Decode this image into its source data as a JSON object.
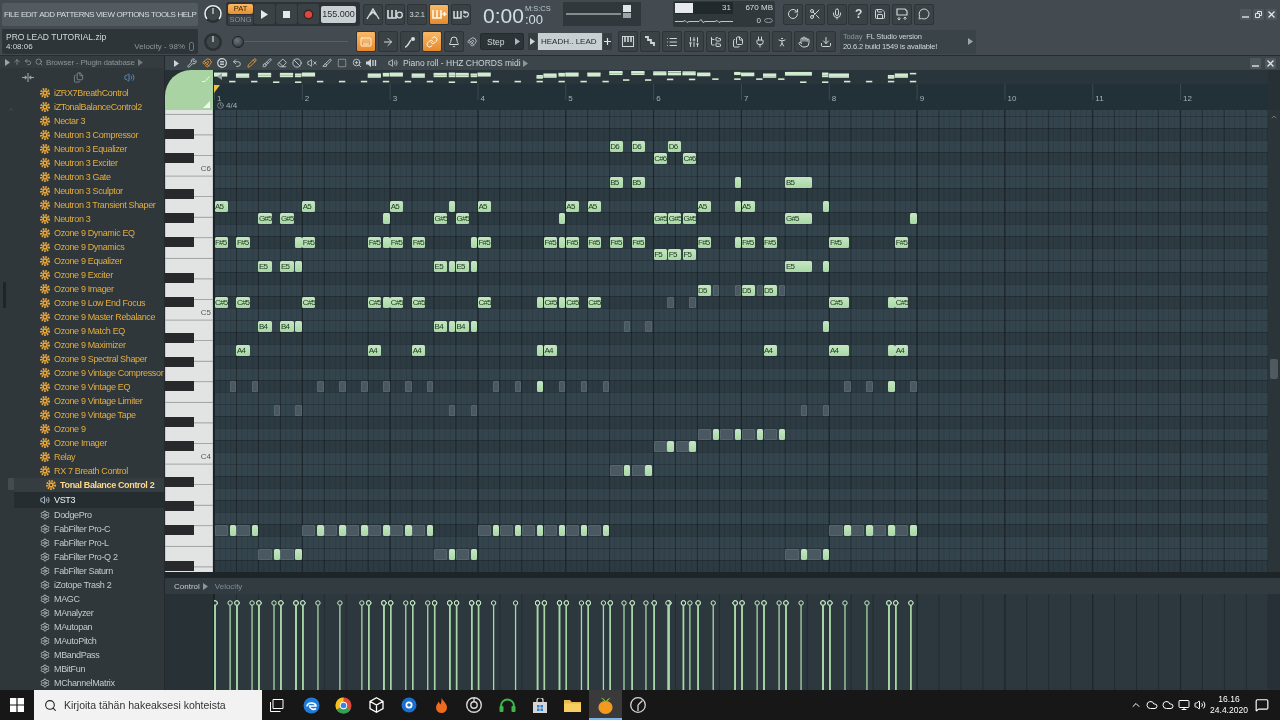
{
  "menu": [
    "FILE",
    "EDIT",
    "ADD",
    "PATTERNS",
    "VIEW",
    "OPTIONS",
    "TOOLS",
    "HELP"
  ],
  "project": {
    "name": "PRO LEAD TUTORIAL.zip",
    "time": "4:08:06",
    "hint": "Velocity - 98%"
  },
  "transport": {
    "mode": [
      {
        "label": "PAT",
        "selected": true
      },
      {
        "label": "SONG",
        "selected": false
      }
    ],
    "tempo": "155.000"
  },
  "record_buttons": [
    {
      "kind": "metronome",
      "on": false
    },
    {
      "kind": "comb-circle",
      "on": false
    },
    {
      "label": "3.2.1",
      "on": false
    },
    {
      "kind": "comb-plus",
      "on": true
    },
    {
      "kind": "comb-loop",
      "on": false
    }
  ],
  "clock": {
    "main": "0:00",
    "sub": ":00",
    "unit": "M:S:CS"
  },
  "monitor": {
    "cpu": "31",
    "level": 0.31,
    "memory": "670 MB",
    "voices": "0"
  },
  "system_buttons": [
    {
      "kind": "refresh"
    },
    {
      "kind": "scissors"
    },
    {
      "kind": "microphone"
    },
    {
      "label": "?"
    },
    {
      "kind": "save"
    },
    {
      "kind": "floppy-arrows"
    },
    {
      "kind": "chat"
    }
  ],
  "edit_buttons": [
    {
      "kind": "keyboard",
      "on": true
    },
    {
      "kind": "arrow-right",
      "on": false
    },
    {
      "kind": "pen-curve",
      "on": false
    },
    {
      "kind": "link",
      "on": true
    },
    {
      "kind": "bell",
      "on": false
    }
  ],
  "snap": {
    "value": "Step"
  },
  "pitch_slider": {
    "level": 0
  },
  "channel": {
    "name": "HEADH.. LEAD"
  },
  "window_buttons": [
    {
      "kind": "piano-keys"
    },
    {
      "kind": "stairs"
    },
    {
      "kind": "list"
    },
    {
      "kind": "sliders"
    },
    {
      "kind": "folder-tree"
    },
    {
      "kind": "pages"
    },
    {
      "kind": "plug"
    },
    {
      "kind": "person"
    },
    {
      "kind": "hand"
    },
    {
      "kind": "download"
    }
  ],
  "hint_panel": {
    "when": "Today",
    "title": "FL Studio version",
    "message": "20.6.2 build 1549 is available!"
  },
  "browser": {
    "title": "Browser - Plugin database",
    "items": [
      {
        "label": "iZRX7BreathControl",
        "kind": "fx",
        "selected": false
      },
      {
        "label": "iZTonalBalanceControl2",
        "kind": "fx",
        "selected": false
      },
      {
        "label": "Nectar 3",
        "kind": "fx",
        "selected": false
      },
      {
        "label": "Neutron 3 Compressor",
        "kind": "fx",
        "selected": false
      },
      {
        "label": "Neutron 3 Equalizer",
        "kind": "fx",
        "selected": false
      },
      {
        "label": "Neutron 3 Exciter",
        "kind": "fx",
        "selected": false
      },
      {
        "label": "Neutron 3 Gate",
        "kind": "fx",
        "selected": false
      },
      {
        "label": "Neutron 3 Sculptor",
        "kind": "fx",
        "selected": false
      },
      {
        "label": "Neutron 3 Transient Shaper",
        "kind": "fx",
        "selected": false
      },
      {
        "label": "Neutron 3",
        "kind": "fx",
        "selected": false
      },
      {
        "label": "Ozone 9 Dynamic EQ",
        "kind": "fx",
        "selected": false
      },
      {
        "label": "Ozone 9 Dynamics",
        "kind": "fx",
        "selected": false
      },
      {
        "label": "Ozone 9 Equalizer",
        "kind": "fx",
        "selected": false
      },
      {
        "label": "Ozone 9 Exciter",
        "kind": "fx",
        "selected": false
      },
      {
        "label": "Ozone 9 Imager",
        "kind": "fx",
        "selected": false
      },
      {
        "label": "Ozone 9 Low End Focus",
        "kind": "fx",
        "selected": false
      },
      {
        "label": "Ozone 9 Master Rebalance",
        "kind": "fx",
        "selected": false
      },
      {
        "label": "Ozone 9 Match EQ",
        "kind": "fx",
        "selected": false
      },
      {
        "label": "Ozone 9 Maximizer",
        "kind": "fx",
        "selected": false
      },
      {
        "label": "Ozone 9 Spectral Shaper",
        "kind": "fx",
        "selected": false
      },
      {
        "label": "Ozone 9 Vintage Compressor",
        "kind": "fx",
        "selected": false
      },
      {
        "label": "Ozone 9 Vintage EQ",
        "kind": "fx",
        "selected": false
      },
      {
        "label": "Ozone 9 Vintage Limiter",
        "kind": "fx",
        "selected": false
      },
      {
        "label": "Ozone 9 Vintage Tape",
        "kind": "fx",
        "selected": false
      },
      {
        "label": "Ozone 9",
        "kind": "fx",
        "selected": false
      },
      {
        "label": "Ozone Imager",
        "kind": "fx",
        "selected": false
      },
      {
        "label": "Relay",
        "kind": "fx",
        "selected": false
      },
      {
        "label": "RX 7 Breath Control",
        "kind": "fx",
        "selected": false
      },
      {
        "label": "Tonal Balance Control 2",
        "kind": "fx",
        "selected": true
      },
      {
        "label": "VST3",
        "kind": "folder",
        "selected": false
      },
      {
        "label": "DodgePro",
        "kind": "vst",
        "selected": false
      },
      {
        "label": "FabFilter Pro-C",
        "kind": "vst",
        "selected": false
      },
      {
        "label": "FabFilter Pro-L",
        "kind": "vst",
        "selected": false
      },
      {
        "label": "FabFilter Pro-Q 2",
        "kind": "vst",
        "selected": false
      },
      {
        "label": "FabFilter Saturn",
        "kind": "vst",
        "selected": false
      },
      {
        "label": "iZotope Trash 2",
        "kind": "vst",
        "selected": false
      },
      {
        "label": "MAGC",
        "kind": "vst",
        "selected": false
      },
      {
        "label": "MAnalyzer",
        "kind": "vst",
        "selected": false
      },
      {
        "label": "MAutopan",
        "kind": "vst",
        "selected": false
      },
      {
        "label": "MAutoPitch",
        "kind": "vst",
        "selected": false
      },
      {
        "label": "MBandPass",
        "kind": "vst",
        "selected": false
      },
      {
        "label": "MBitFun",
        "kind": "vst",
        "selected": false
      },
      {
        "label": "MChannelMatrix",
        "kind": "vst",
        "selected": false
      }
    ]
  },
  "piano_roll": {
    "title": "Piano roll - HHZ CHORDS midi",
    "tools": [
      {
        "kind": "caret-right",
        "on": false
      },
      {
        "kind": "wrench",
        "on": false
      },
      {
        "kind": "magnet",
        "on": true
      },
      {
        "kind": "circle-lines",
        "on": false
      },
      {
        "kind": "undo",
        "on": false
      },
      {
        "kind": "pencil",
        "on": true
      },
      {
        "kind": "brush",
        "on": false
      },
      {
        "kind": "eraser",
        "on": false
      },
      {
        "kind": "ban",
        "on": false
      },
      {
        "kind": "speaker-off",
        "on": false
      },
      {
        "kind": "knife",
        "on": false
      },
      {
        "kind": "dashed-square",
        "on": false
      },
      {
        "kind": "zoom",
        "on": false
      },
      {
        "kind": "speaker-bars",
        "on": false
      }
    ],
    "bars": [
      "1",
      "2",
      "3",
      "4",
      "5",
      "6",
      "7",
      "8",
      "9",
      "10",
      "11",
      "12"
    ],
    "time_signature": "4/4",
    "key_labels": [
      "C6",
      "C5",
      "C4"
    ],
    "notes": [
      {
        "label": "D6",
        "ghost": false
      },
      {
        "label": "D6",
        "ghost": false
      },
      {
        "label": "D6",
        "ghost": false
      },
      {
        "label": "C#6",
        "ghost": false
      },
      {
        "label": "C#6",
        "ghost": false
      },
      {
        "label": "B5",
        "ghost": false
      },
      {
        "label": "B5",
        "ghost": false
      },
      {
        "ghost": false
      },
      {
        "label": "B5",
        "ghost": false
      },
      {
        "label": "A5",
        "ghost": false
      },
      {
        "label": "A5",
        "ghost": false
      },
      {
        "label": "A5",
        "ghost": false
      },
      {
        "ghost": false
      },
      {
        "label": "A5",
        "ghost": false
      },
      {
        "label": "A5",
        "ghost": false
      },
      {
        "label": "A5",
        "ghost": false
      },
      {
        "label": "A5",
        "ghost": false
      },
      {
        "ghost": false
      },
      {
        "label": "A5",
        "ghost": false
      },
      {
        "ghost": false
      },
      {
        "label": "G#5",
        "ghost": false
      },
      {
        "label": "G#5",
        "ghost": false
      },
      {
        "ghost": false
      },
      {
        "label": "G#5",
        "ghost": false
      },
      {
        "label": "G#5",
        "ghost": false
      },
      {
        "ghost": false
      },
      {
        "label": "G#5",
        "ghost": false
      },
      {
        "label": "G#5",
        "ghost": false
      },
      {
        "label": "G#5",
        "ghost": false
      },
      {
        "label": "G#5",
        "ghost": false
      },
      {
        "ghost": false
      },
      {
        "label": "F#5",
        "ghost": false
      },
      {
        "label": "F#5",
        "ghost": false
      },
      {
        "ghost": false
      },
      {
        "label": "F#5",
        "ghost": false
      },
      {
        "label": "F#5",
        "ghost": false
      },
      {
        "ghost": false
      },
      {
        "label": "F#5",
        "ghost": false
      },
      {
        "label": "F#5",
        "ghost": false
      },
      {
        "ghost": false
      },
      {
        "label": "F#5",
        "ghost": false
      },
      {
        "label": "F#5",
        "ghost": false
      },
      {
        "ghost": false
      },
      {
        "label": "F#5",
        "ghost": false
      },
      {
        "label": "F#5",
        "ghost": false
      },
      {
        "label": "F#5",
        "ghost": false
      },
      {
        "label": "F#5",
        "ghost": false
      },
      {
        "label": "F#5",
        "ghost": false
      },
      {
        "ghost": false
      },
      {
        "label": "F#5",
        "ghost": false
      },
      {
        "label": "F#5",
        "ghost": false
      },
      {
        "label": "F#5",
        "ghost": false
      },
      {
        "label": "F#5",
        "ghost": false
      },
      {
        "label": "F5",
        "ghost": false
      },
      {
        "label": "F5",
        "ghost": false
      },
      {
        "label": "F5",
        "ghost": false
      },
      {
        "label": "E5",
        "ghost": false
      },
      {
        "label": "E5",
        "ghost": false
      },
      {
        "ghost": false
      },
      {
        "label": "E5",
        "ghost": false
      },
      {
        "ghost": false
      },
      {
        "label": "E5",
        "ghost": false
      },
      {
        "ghost": false
      },
      {
        "label": "E5",
        "ghost": false
      },
      {
        "ghost": false
      },
      {
        "label": "D5",
        "ghost": false
      },
      {
        "ghost": true
      },
      {
        "ghost": true
      },
      {
        "label": "D5",
        "ghost": false
      },
      {
        "ghost": true
      },
      {
        "label": "D5",
        "ghost": false
      },
      {
        "ghost": true
      },
      {
        "label": "C#5",
        "ghost": false
      },
      {
        "label": "C#5",
        "ghost": false
      },
      {
        "label": "C#5",
        "ghost": false
      },
      {
        "label": "C#5",
        "ghost": false
      },
      {
        "ghost": false
      },
      {
        "label": "C#5",
        "ghost": false
      },
      {
        "label": "C#5",
        "ghost": false
      },
      {
        "label": "C#5",
        "ghost": false
      },
      {
        "ghost": false
      },
      {
        "label": "C#5",
        "ghost": false
      },
      {
        "ghost": false
      },
      {
        "label": "C#5",
        "ghost": false
      },
      {
        "label": "C#5",
        "ghost": false
      },
      {
        "ghost": true
      },
      {
        "ghost": true
      },
      {
        "label": "C#5",
        "ghost": false
      },
      {
        "ghost": false
      },
      {
        "label": "C#5",
        "ghost": false
      },
      {
        "label": "B4",
        "ghost": false
      },
      {
        "label": "B4",
        "ghost": false
      },
      {
        "ghost": false
      },
      {
        "label": "B4",
        "ghost": false
      },
      {
        "ghost": false
      },
      {
        "label": "B4",
        "ghost": false
      },
      {
        "ghost": false
      },
      {
        "ghost": true
      },
      {
        "ghost": true
      },
      {
        "ghost": false
      },
      {
        "label": "A4",
        "ghost": false
      },
      {
        "label": "A4",
        "ghost": false
      },
      {
        "label": "A4",
        "ghost": false
      },
      {
        "ghost": false
      },
      {
        "label": "A4",
        "ghost": false
      },
      {
        "label": "A4",
        "ghost": false
      },
      {
        "label": "A4",
        "ghost": false
      },
      {
        "ghost": false
      },
      {
        "label": "A4",
        "ghost": false
      },
      {
        "ghost": true
      },
      {
        "ghost": true
      },
      {
        "ghost": true
      },
      {
        "ghost": true
      },
      {
        "ghost": true
      },
      {
        "ghost": true
      },
      {
        "ghost": true
      },
      {
        "ghost": true
      },
      {
        "ghost": true
      },
      {
        "ghost": true
      },
      {
        "ghost": false
      },
      {
        "ghost": true
      },
      {
        "ghost": true
      },
      {
        "ghost": true
      },
      {
        "ghost": true
      },
      {
        "ghost": true
      },
      {
        "ghost": false
      },
      {
        "ghost": true
      },
      {
        "ghost": true
      },
      {
        "ghost": true
      },
      {
        "ghost": true
      },
      {
        "ghost": true
      },
      {
        "ghost": true
      },
      {
        "ghost": true
      },
      {
        "ghost": true
      },
      {
        "ghost": false
      },
      {
        "ghost": true
      },
      {
        "ghost": false
      },
      {
        "ghost": true
      },
      {
        "ghost": false
      },
      {
        "ghost": true
      },
      {
        "ghost": false
      },
      {
        "ghost": true
      },
      {
        "ghost": false
      },
      {
        "ghost": true
      },
      {
        "ghost": false
      },
      {
        "ghost": true
      },
      {
        "ghost": false
      },
      {
        "ghost": true
      },
      {
        "ghost": false
      },
      {
        "ghost": true
      },
      {
        "ghost": false
      },
      {
        "ghost": true
      },
      {
        "ghost": false
      },
      {
        "ghost": true
      },
      {
        "ghost": false
      },
      {
        "ghost": true
      },
      {
        "ghost": false
      },
      {
        "ghost": true
      },
      {
        "ghost": false
      },
      {
        "ghost": true
      },
      {
        "ghost": false
      },
      {
        "ghost": true
      },
      {
        "ghost": false
      },
      {
        "ghost": true
      },
      {
        "ghost": false
      },
      {
        "ghost": true
      },
      {
        "ghost": false
      },
      {
        "ghost": true
      },
      {
        "ghost": false
      },
      {
        "ghost": true
      },
      {
        "ghost": false
      },
      {
        "ghost": true
      },
      {
        "ghost": false
      },
      {
        "ghost": true
      },
      {
        "ghost": false
      },
      {
        "ghost": true
      },
      {
        "ghost": false
      },
      {
        "ghost": true
      },
      {
        "ghost": false
      },
      {
        "ghost": true
      },
      {
        "ghost": false
      },
      {
        "ghost": true
      },
      {
        "ghost": false
      },
      {
        "ghost": true
      },
      {
        "ghost": false
      },
      {
        "ghost": true
      },
      {
        "ghost": false
      },
      {
        "ghost": true
      },
      {
        "ghost": false
      },
      {
        "ghost": true
      },
      {
        "ghost": false
      },
      {
        "ghost": true
      },
      {
        "ghost": false
      },
      {
        "ghost": true
      },
      {
        "ghost": false
      },
      {
        "ghost": true
      },
      {
        "ghost": false
      }
    ],
    "control": {
      "label": "Control",
      "target": "Velocity"
    }
  },
  "taskbar": {
    "search": {
      "placeholder": "Kirjoita tähän hakeaksesi kohteista"
    },
    "apps": [
      {
        "kind": "task-view",
        "selected": false
      },
      {
        "kind": "wave-logo",
        "selected": false
      },
      {
        "kind": "ring-logo",
        "selected": false
      },
      {
        "kind": "cube",
        "selected": false
      },
      {
        "kind": "orb",
        "selected": false
      },
      {
        "kind": "flame",
        "selected": false
      },
      {
        "kind": "swirl",
        "selected": false
      },
      {
        "kind": "headphones",
        "selected": false
      },
      {
        "kind": "bag",
        "selected": false
      },
      {
        "kind": "folder",
        "selected": false
      },
      {
        "kind": "fruit",
        "selected": true
      },
      {
        "kind": "disc",
        "selected": false
      }
    ],
    "tray": [
      {
        "kind": "caret-up"
      },
      {
        "kind": "cloud"
      },
      {
        "kind": "cloud"
      },
      {
        "kind": "monitor"
      },
      {
        "kind": "speaker"
      }
    ],
    "time": "16.16",
    "date": "24.4.2020"
  }
}
